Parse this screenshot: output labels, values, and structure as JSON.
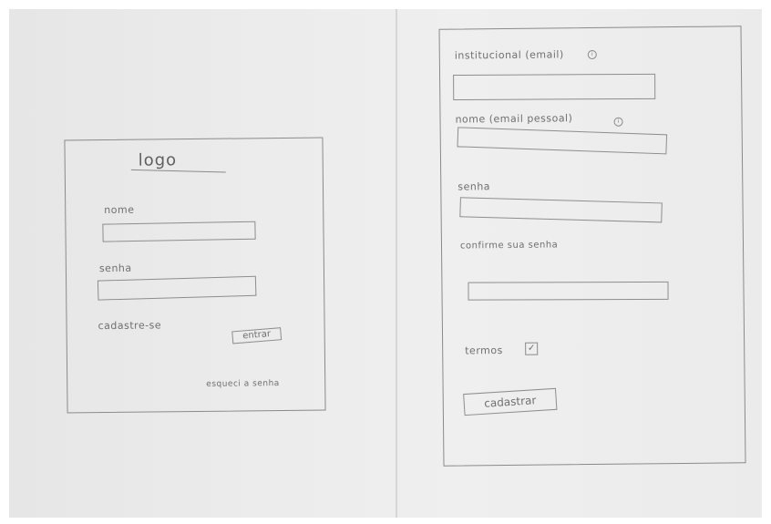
{
  "login": {
    "logo": "logo",
    "name_label": "nome",
    "password_label": "senha",
    "register_link": "cadastre-se",
    "enter_button": "entrar",
    "forgot_link": "esqueci a senha"
  },
  "signup": {
    "institutional_email_label": "institucional (email)",
    "personal_name_label": "nome (email pessoal)",
    "password_label": "senha",
    "confirm_password_label": "confirme sua senha",
    "terms_label": "termos",
    "terms_checked": "✓",
    "register_button": "cadastrar"
  }
}
